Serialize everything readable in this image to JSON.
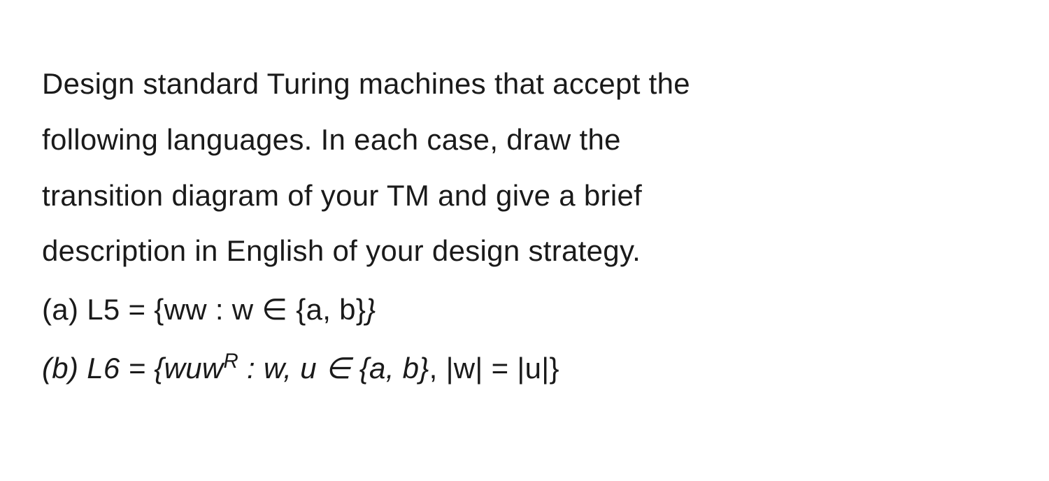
{
  "intro": {
    "line1": "Design standard Turing machines that accept the",
    "line2": "following languages. In each case, draw the",
    "line3": "transition diagram of your TM and give a brief",
    "line4": "description in English of your design strategy."
  },
  "partA": {
    "label": "(a) L5 = {ww : w ",
    "elem": "∈",
    "setOpen": " {a, b}",
    "closeBrace": "}"
  },
  "partB": {
    "label": "(b) L6 = {wuw",
    "superR": "R",
    "mid": " : w, u ",
    "elem": "∈",
    "setText": " {a, b}",
    "comma": ", ",
    "lenW": "|w| = |u|}"
  }
}
